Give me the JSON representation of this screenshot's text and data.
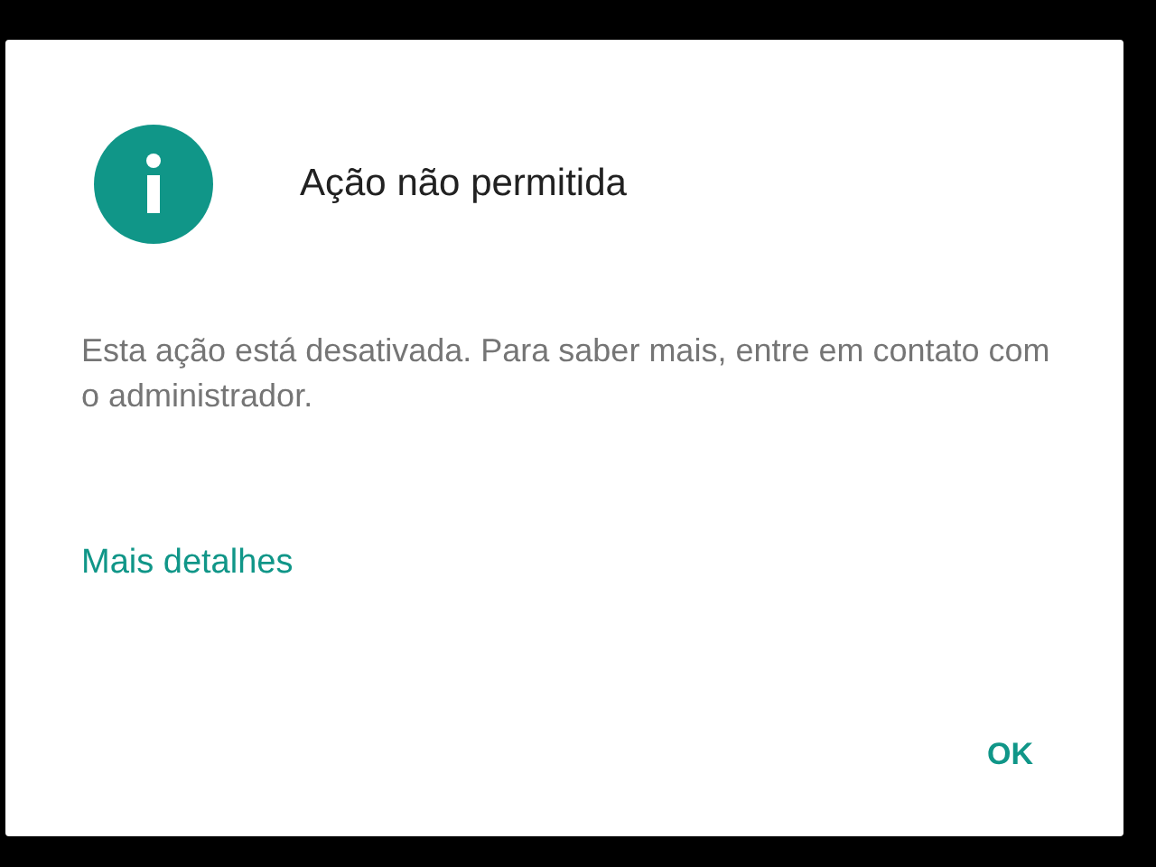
{
  "dialog": {
    "title": "Ação não permitida",
    "message": "Esta ação está desativada. Para saber mais, entre em contato com o administrador.",
    "link": "Mais detalhes",
    "buttons": [
      "OK"
    ]
  }
}
